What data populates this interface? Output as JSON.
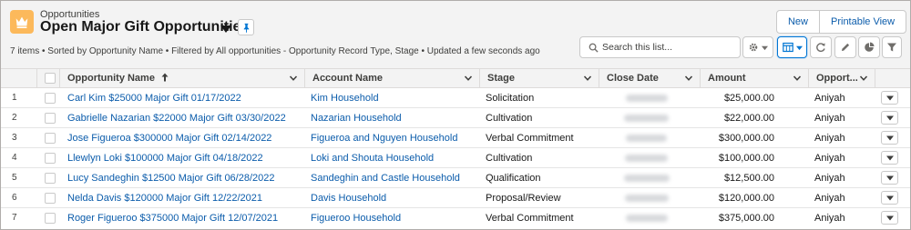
{
  "header": {
    "object_label": "Opportunities",
    "list_title": "Open Major Gift Opportunities",
    "info": "7 items • Sorted by Opportunity Name • Filtered by All opportunities - Opportunity Record Type, Stage • Updated a few seconds ago",
    "new_label": "New",
    "printable_label": "Printable View",
    "icons": {
      "object": "crown-icon",
      "title_menu": "chevron-down-icon",
      "pin": "pin-icon",
      "search": "search-icon",
      "settings": "gear-icon",
      "display_as": "table-icon",
      "refresh": "refresh-icon",
      "edit": "pencil-icon",
      "charts": "pie-chart-icon",
      "filters": "filter-icon"
    }
  },
  "search": {
    "placeholder": "Search this list...",
    "value": ""
  },
  "table": {
    "columns": [
      "Opportunity Name",
      "Account Name",
      "Stage",
      "Close Date",
      "Amount",
      "Opport..."
    ],
    "sorted_column": "Opportunity Name",
    "rows": [
      {
        "num": "1",
        "name": "Carl Kim $25000 Major Gift 01/17/2022",
        "account": "Kim Household",
        "stage": "Solicitation",
        "amount": "$25,000.00",
        "owner": "Aniyah"
      },
      {
        "num": "2",
        "name": "Gabrielle Nazarian $22000 Major Gift 03/30/2022",
        "account": "Nazarian Household",
        "stage": "Cultivation",
        "amount": "$22,000.00",
        "owner": "Aniyah"
      },
      {
        "num": "3",
        "name": "Jose Figueroa $300000 Major Gift 02/14/2022",
        "account": "Figueroa and Nguyen Household",
        "stage": "Verbal Commitment",
        "amount": "$300,000.00",
        "owner": "Aniyah"
      },
      {
        "num": "4",
        "name": "Llewlyn Loki $100000 Major Gift 04/18/2022",
        "account": "Loki and Shouta Household",
        "stage": "Cultivation",
        "amount": "$100,000.00",
        "owner": "Aniyah"
      },
      {
        "num": "5",
        "name": "Lucy Sandeghin $12500 Major Gift 06/28/2022",
        "account": "Sandeghin and Castle Household",
        "stage": "Qualification",
        "amount": "$12,500.00",
        "owner": "Aniyah"
      },
      {
        "num": "6",
        "name": "Nelda Davis $120000 Major Gift 12/22/2021",
        "account": "Davis Household",
        "stage": "Proposal/Review",
        "amount": "$120,000.00",
        "owner": "Aniyah"
      },
      {
        "num": "7",
        "name": "Roger Figueroo $375000 Major Gift 12/07/2021",
        "account": "Figueroo Household",
        "stage": "Verbal Commitment",
        "amount": "$375,000.00",
        "owner": "Aniyah"
      }
    ]
  },
  "colors": {
    "accent": "#0176d3",
    "link": "#0b5cab",
    "object_icon": "#fcb95b"
  }
}
